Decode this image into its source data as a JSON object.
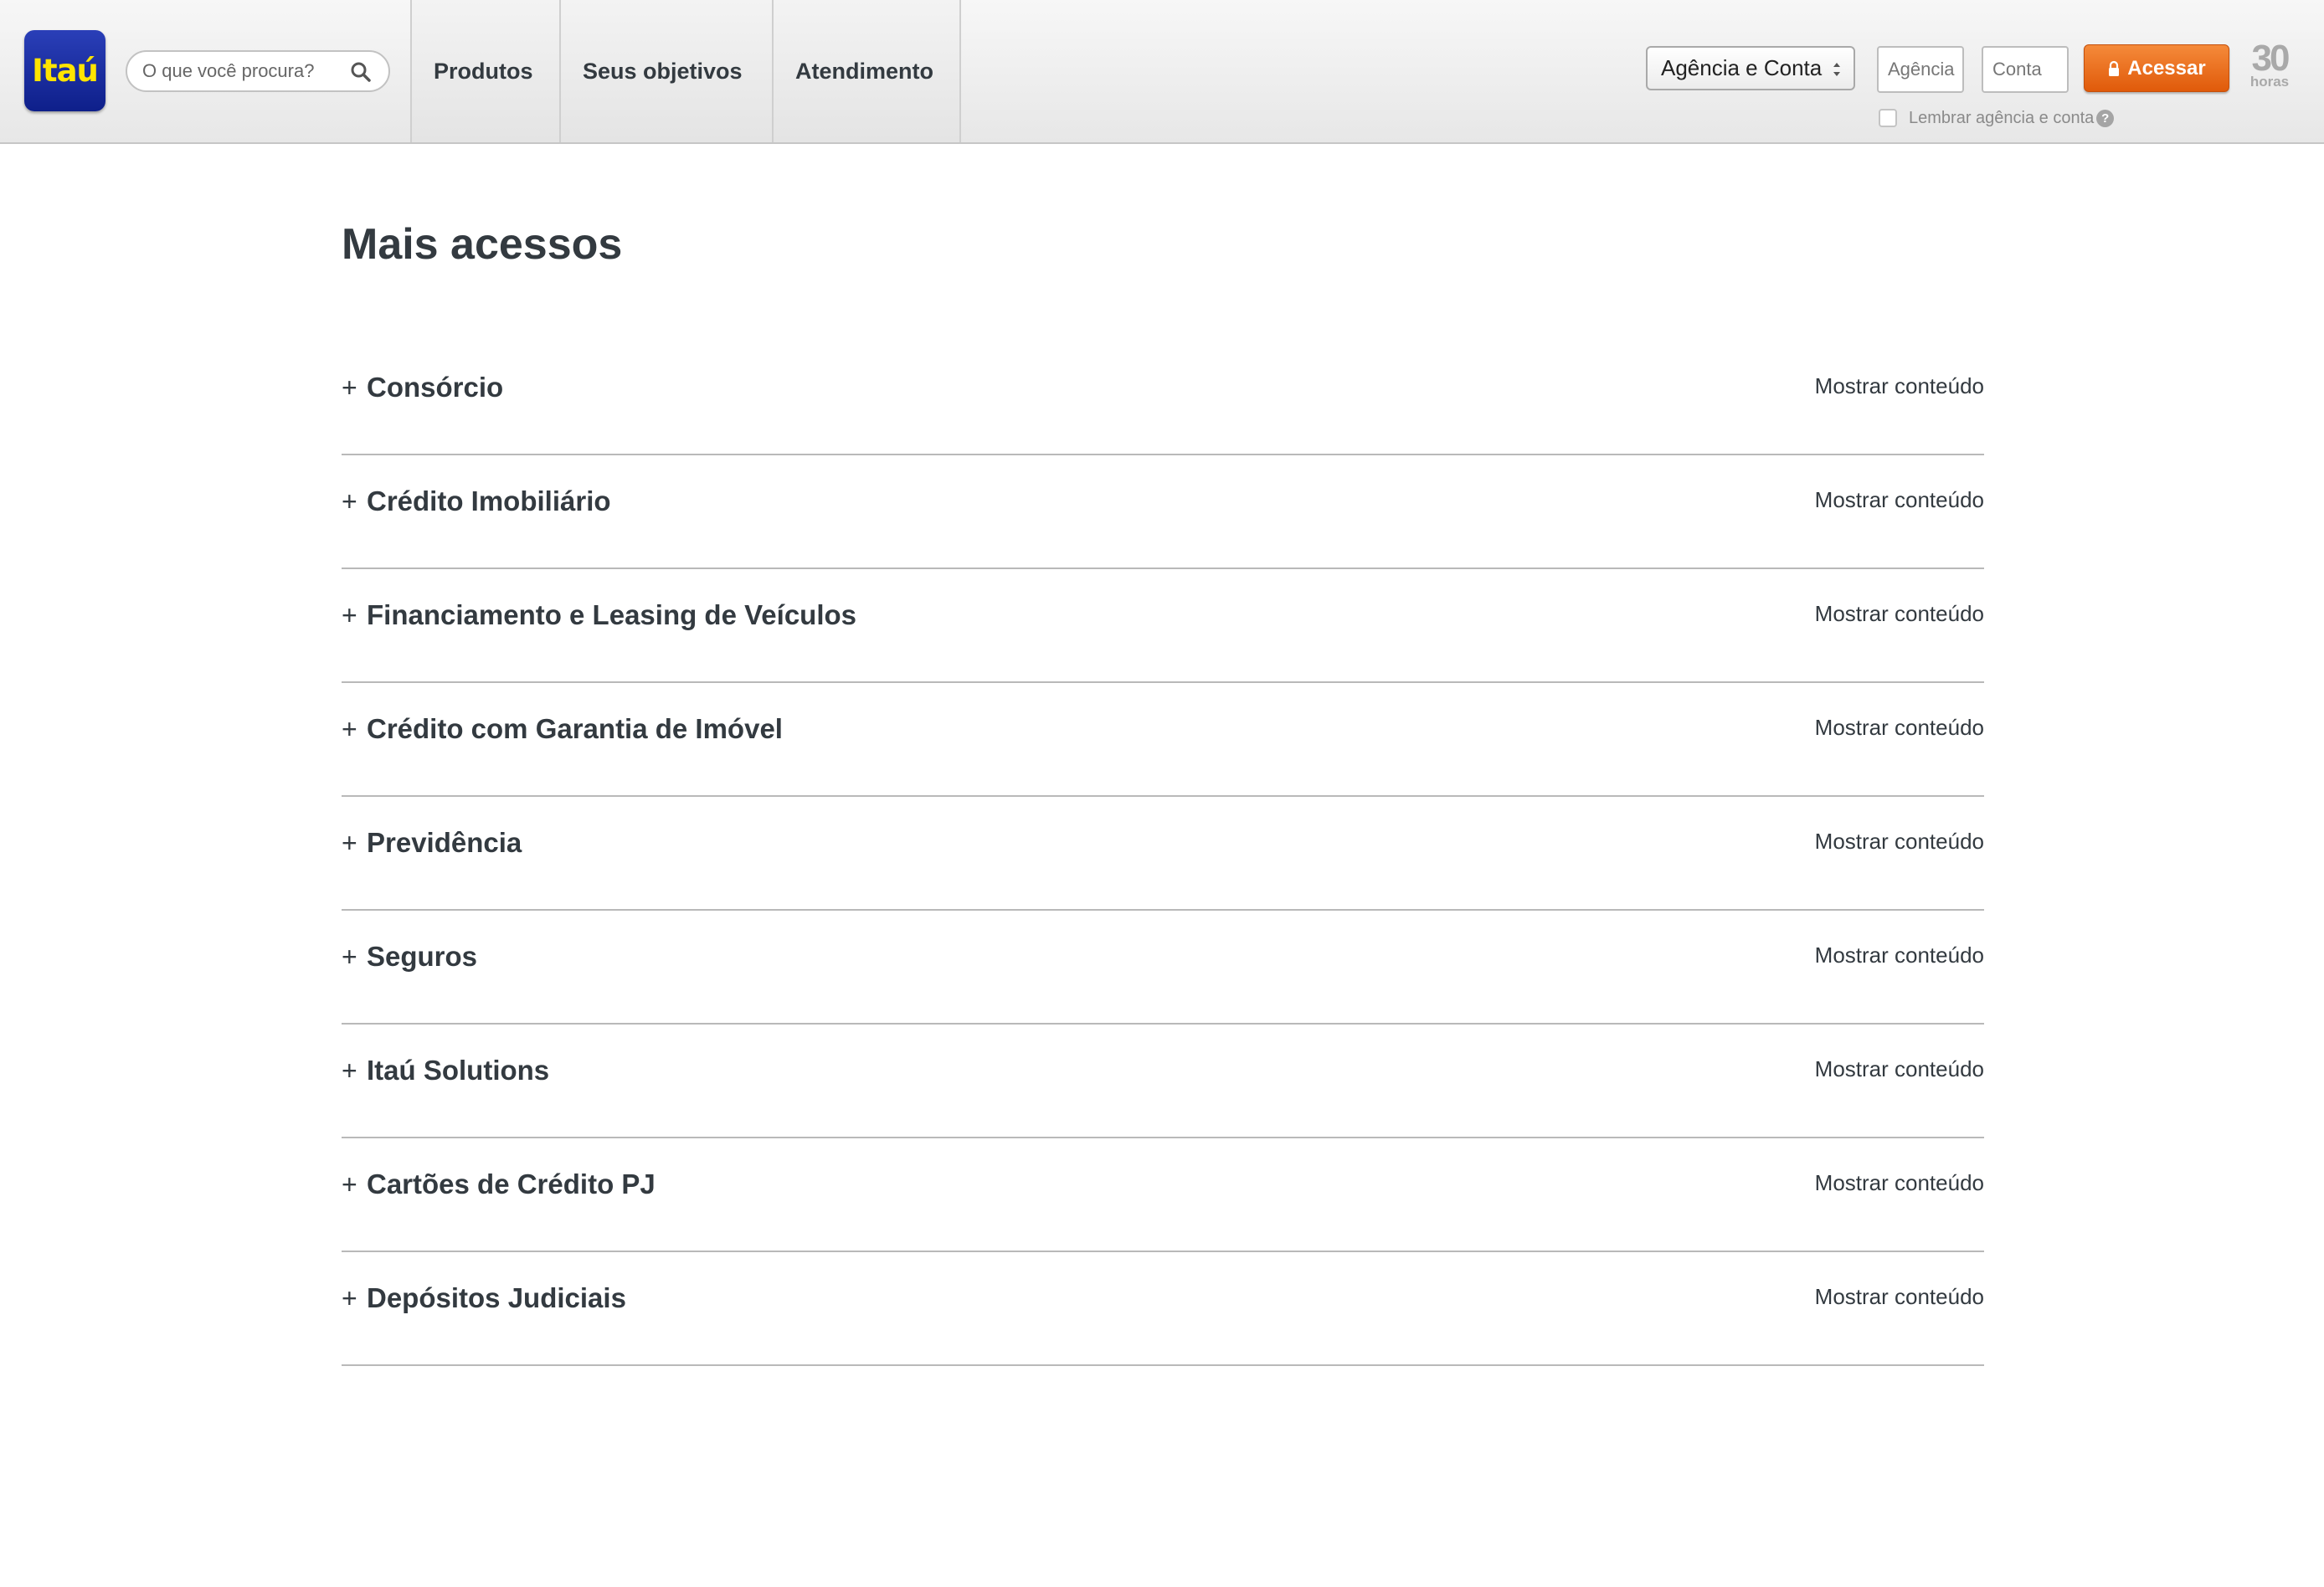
{
  "header": {
    "logo_text": "Itaú",
    "search_placeholder": "O que você procura?",
    "nav": [
      "Produtos",
      "Seus objetivos",
      "Atendimento"
    ],
    "account_type_select": "Agência e Conta",
    "agencia_placeholder": "Agência",
    "conta_placeholder": "Conta",
    "access_button": "Acessar",
    "badge_number": "30",
    "badge_label": "horas",
    "remember_label": "Lembrar agência e conta",
    "help_symbol": "?",
    "colors": {
      "logo_bg": "#1a2fa0",
      "logo_text": "#ffe400",
      "access_button": "#ec6f1e"
    }
  },
  "main": {
    "title": "Mais acessos",
    "toggle_symbol": "+",
    "items": [
      {
        "label": "Consórcio",
        "action": "Mostrar conteúdo"
      },
      {
        "label": "Crédito Imobiliário",
        "action": "Mostrar conteúdo"
      },
      {
        "label": "Financiamento e Leasing de Veículos",
        "action": "Mostrar conteúdo"
      },
      {
        "label": "Crédito com Garantia de Imóvel",
        "action": "Mostrar conteúdo"
      },
      {
        "label": "Previdência",
        "action": "Mostrar conteúdo"
      },
      {
        "label": "Seguros",
        "action": "Mostrar conteúdo"
      },
      {
        "label": "Itaú Solutions",
        "action": "Mostrar conteúdo"
      },
      {
        "label": "Cartões de Crédito PJ",
        "action": "Mostrar conteúdo"
      },
      {
        "label": "Depósitos Judiciais",
        "action": "Mostrar conteúdo"
      }
    ]
  },
  "icons": {
    "search": "search-icon",
    "lock": "lock-icon",
    "select_arrows": "select-arrows-icon",
    "help": "help-icon"
  }
}
